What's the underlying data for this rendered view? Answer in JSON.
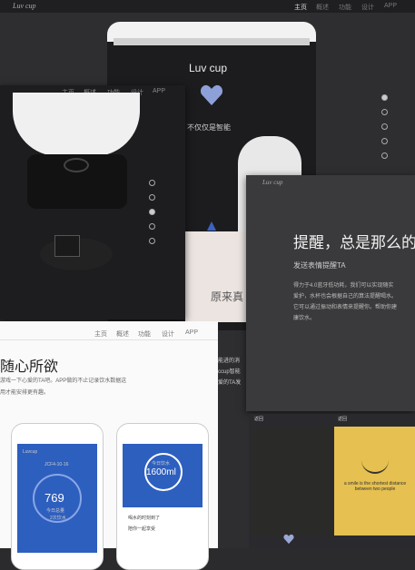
{
  "top_nav": {
    "logo": "Luv cup",
    "items": [
      "主页",
      "概述",
      "功能",
      "设计",
      "APP"
    ]
  },
  "hero": {
    "title": "Luv cup",
    "tagline": "不仅仅是智能"
  },
  "left_panel": {
    "nav": [
      "主页",
      "概述",
      "功能",
      "设计",
      "APP"
    ]
  },
  "right_panel": {
    "logo": "Luv cup",
    "title": "提醒，总是那么的",
    "subtitle": "发送表情提醒TA",
    "body": [
      "得力于4.0蓝牙低功耗，我们可以实现随实",
      "爱护，水杯也会根据自己的算法提醒喝水。",
      "它可以通过振动和表情来提醒你。帮助你建",
      "康饮水。"
    ]
  },
  "paper": {
    "text": "原来真"
  },
  "bottom_panel": {
    "nav": [
      "主页",
      "概述",
      "功能",
      "设计",
      "APP"
    ],
    "title": "随心所欲",
    "body": [
      "游戏一下心爱的TA吧。APP做的不止记录饮水数据这",
      "用才能安排更有趣。"
    ],
    "mid_text": [
      "能进的消",
      "ccup智能",
      "爱的TA发"
    ],
    "phone1": {
      "brand": "Luvcup",
      "date": "JCF4-10-16",
      "value": "769",
      "unit": "今日总量",
      "sub": "2次饮水"
    },
    "phone2": {
      "label": "今日饮水",
      "value": "1600ml",
      "note1": "喝水的时刻到了",
      "note2": "陪你一起享受"
    }
  },
  "bottom_right": {
    "left_title": "返回",
    "right_title": "返回",
    "quote": "a smile is the shortest distance between two people"
  },
  "dots": {
    "hero": [
      true,
      false,
      false,
      false,
      false
    ],
    "left": [
      false,
      false,
      true,
      false,
      false
    ]
  }
}
